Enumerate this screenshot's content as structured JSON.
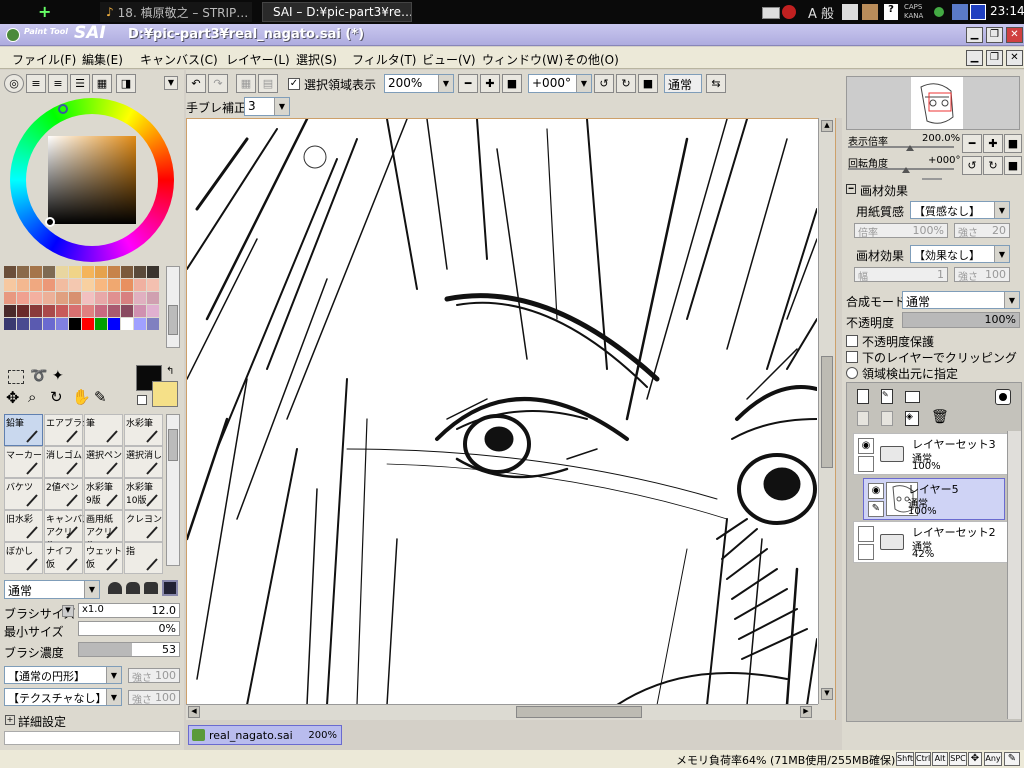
{
  "taskbar": {
    "task1": "18. 槙原敬之 – STRIP…",
    "task2": "SAI – D:¥pic-part3¥re…",
    "caps": "CAPS",
    "kana": "KANA",
    "ime": "A 般",
    "clock": "23:14"
  },
  "titlebar": {
    "logo_small": "Paint Tool",
    "logo_big": "SAI",
    "title": "D:¥pic-part3¥real_nagato.sai (*)"
  },
  "menu": [
    "ファイル(F)",
    "編集(E)",
    "キャンバス(C)",
    "レイヤー(L)",
    "選択(S)",
    "フィルタ(T)",
    "ビュー(V)",
    "ウィンドウ(W)",
    "その他(O)"
  ],
  "toolbar": {
    "show_selection_label": "選択領域表示",
    "show_selection": true,
    "zoom": "200%",
    "rotation": "+000°",
    "blend_mode": "通常",
    "stabilizer_label": "手ブレ補正",
    "stabilizer": "3"
  },
  "tools": [
    {
      "label": "鉛筆",
      "sub": ""
    },
    {
      "label": "エアブラシ",
      "sub": ""
    },
    {
      "label": "筆",
      "sub": ""
    },
    {
      "label": "水彩筆",
      "sub": ""
    },
    {
      "label": "マーカー",
      "sub": ""
    },
    {
      "label": "消しゴム",
      "sub": ""
    },
    {
      "label": "選択ペン",
      "sub": ""
    },
    {
      "label": "選択消し",
      "sub": ""
    },
    {
      "label": "バケツ",
      "sub": ""
    },
    {
      "label": "2値ペン",
      "sub": ""
    },
    {
      "label": "水彩筆",
      "sub": "9版"
    },
    {
      "label": "水彩筆",
      "sub": "10版"
    },
    {
      "label": "旧水彩",
      "sub": ""
    },
    {
      "label": "キャンバス",
      "sub": "アクリル"
    },
    {
      "label": "画用紙",
      "sub": "アクリル"
    },
    {
      "label": "クレヨン",
      "sub": ""
    },
    {
      "label": "ぼかし",
      "sub": ""
    },
    {
      "label": "ナイフ",
      "sub": "仮"
    },
    {
      "label": "ウェット",
      "sub": "仮"
    },
    {
      "label": "指",
      "sub": ""
    }
  ],
  "brush": {
    "mode": "通常",
    "size_label": "ブラシサイズ",
    "size_mult": "x1.0",
    "size_value": "12.0",
    "min_size_label": "最小サイズ",
    "min_size_value": "0%",
    "min_size_fraction": 0.0,
    "density_label": "ブラシ濃度",
    "density_value": "53",
    "density_fraction": 0.53,
    "shape": "【通常の円形】",
    "shape_strength_label": "強さ",
    "shape_strength": "100",
    "texture": "【テクスチャなし】",
    "texture_strength_label": "強さ",
    "texture_strength": "100",
    "detail_label": "詳細設定"
  },
  "navigator": {
    "zoom_label": "表示倍率",
    "zoom_value": "200.0%",
    "rotation_label": "回転角度",
    "rotation_value": "+000°"
  },
  "material": {
    "header": "画材効果",
    "paper_label": "用紙質感",
    "paper_value": "【質感なし】",
    "paper_scale_label": "倍率",
    "paper_scale": "100%",
    "paper_strength_label": "強さ",
    "paper_strength": "20",
    "effect_label": "画材効果",
    "effect_value": "【効果なし】",
    "effect_width_label": "幅",
    "effect_width": "1",
    "effect_strength_label": "強さ",
    "effect_strength": "100"
  },
  "layerprops": {
    "blend_label": "合成モード",
    "blend_value": "通常",
    "opacity_label": "不透明度",
    "opacity_value": "100%",
    "opacity_fraction": 1.0,
    "preserve_label": "不透明度保護",
    "clip_label": "下のレイヤーでクリッピング",
    "source_label": "領域検出元に指定"
  },
  "layers": [
    {
      "name": "レイヤーセット3",
      "mode": "通常",
      "opacity": "100%",
      "type": "folder",
      "selected": false
    },
    {
      "name": "レイヤー5",
      "mode": "通常",
      "opacity": "100%",
      "type": "layer",
      "selected": true
    },
    {
      "name": "レイヤーセット2",
      "mode": "通常",
      "opacity": "42%",
      "type": "folder",
      "selected": false
    }
  ],
  "doc_tab": {
    "name": "real_nagato.sai",
    "zoom": "200%"
  },
  "status": {
    "memory": "メモリ負荷率64% (71MB使用/255MB確保)",
    "keys": [
      "Shft",
      "Ctrl",
      "Alt",
      "SPC",
      "Any"
    ]
  },
  "colors": {
    "primary": "#0a0a0a",
    "secondary": "#f5e088",
    "accent": "#6a6ad0",
    "titlebar": "#aeacdf"
  },
  "swatches": [
    "#6b4f3a",
    "#8a6a4a",
    "#a5754a",
    "#7e6a52",
    "#e8d6a0",
    "#f0d488",
    "#f4b45a",
    "#e6a24c",
    "#c7834a",
    "#7b5a3c",
    "#5a4a3a",
    "#3a342e",
    "#f6c8a0",
    "#f4b890",
    "#f0a880",
    "#ec9878",
    "#f2bca0",
    "#f4c8b0",
    "#f8d0a0",
    "#f8b880",
    "#f0a870",
    "#e89060",
    "#f0b0a0",
    "#f4c0b0",
    "#e89880",
    "#f0a090",
    "#f4b0a0",
    "#ecb098",
    "#e0a080",
    "#d89070",
    "#f2c0c0",
    "#e8a8a8",
    "#e09090",
    "#d88080",
    "#e0b0c0",
    "#d0a0b0",
    "#4a2a2a",
    "#6a2a2a",
    "#8a3a3a",
    "#aa4a4a",
    "#c85a5a",
    "#d87070",
    "#e08080",
    "#c86a80",
    "#a85a70",
    "#8a4a60",
    "#d090b0",
    "#e0b0d0",
    "#3a3a70",
    "#4a4a90",
    "#5a5ab0",
    "#6a6ad0",
    "#8080e0",
    "#000000",
    "#ff0000",
    "#00a000",
    "#0000ff",
    "#ffffff",
    "#a0a0ff",
    "#8080c0"
  ]
}
